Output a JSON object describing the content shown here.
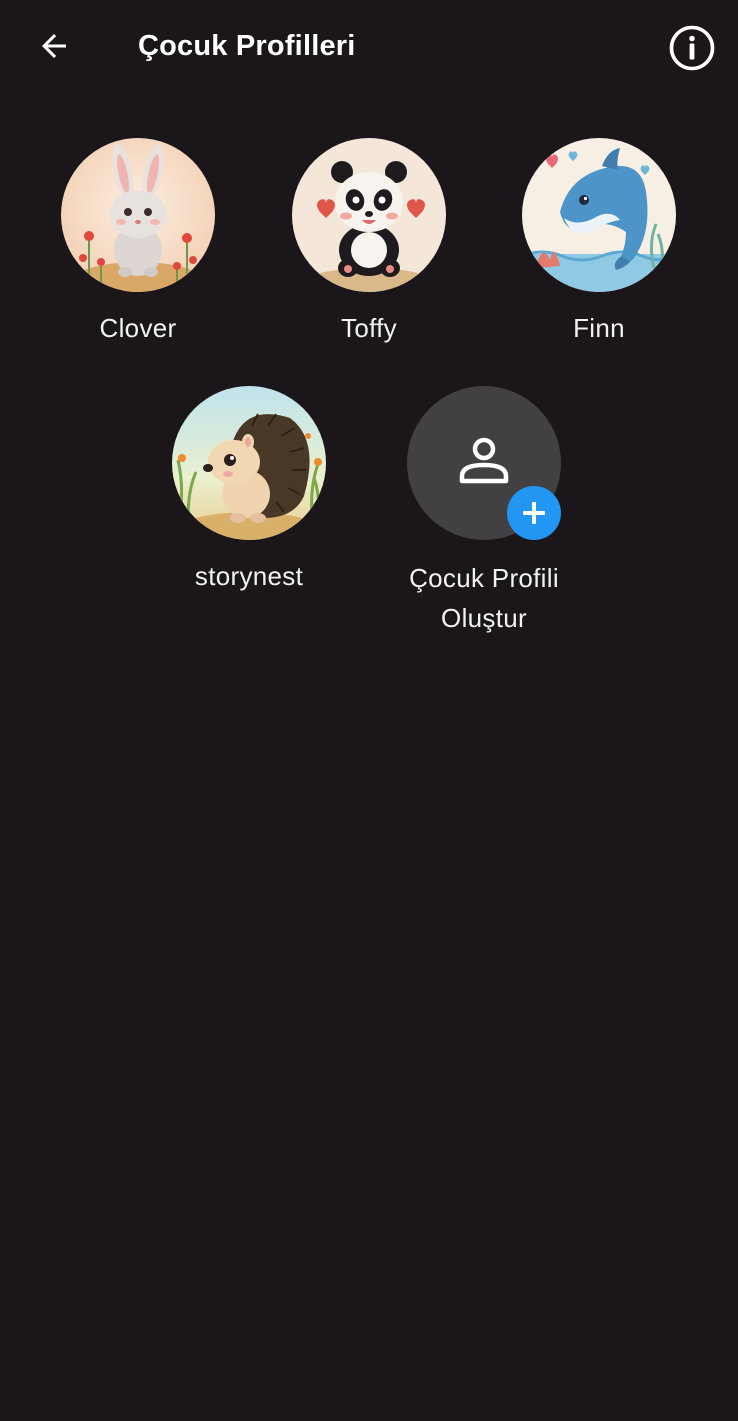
{
  "header": {
    "title": "Çocuk Profilleri",
    "back_icon": "arrow-left-icon",
    "info_icon": "info-circle-icon"
  },
  "profiles": [
    {
      "name": "Clover",
      "avatar": "bunny-avatar"
    },
    {
      "name": "Toffy",
      "avatar": "panda-avatar"
    },
    {
      "name": "Finn",
      "avatar": "dolphin-avatar"
    },
    {
      "name": "storynest",
      "avatar": "hedgehog-avatar"
    }
  ],
  "create_profile": {
    "label_line1": "Çocuk Profili",
    "label_line2": "Oluştur",
    "icon": "person-icon",
    "badge_icon": "plus-icon"
  },
  "colors": {
    "background": "#1a161a",
    "accent": "#2196f3",
    "create_circle": "#424042",
    "text": "#ffffff"
  }
}
